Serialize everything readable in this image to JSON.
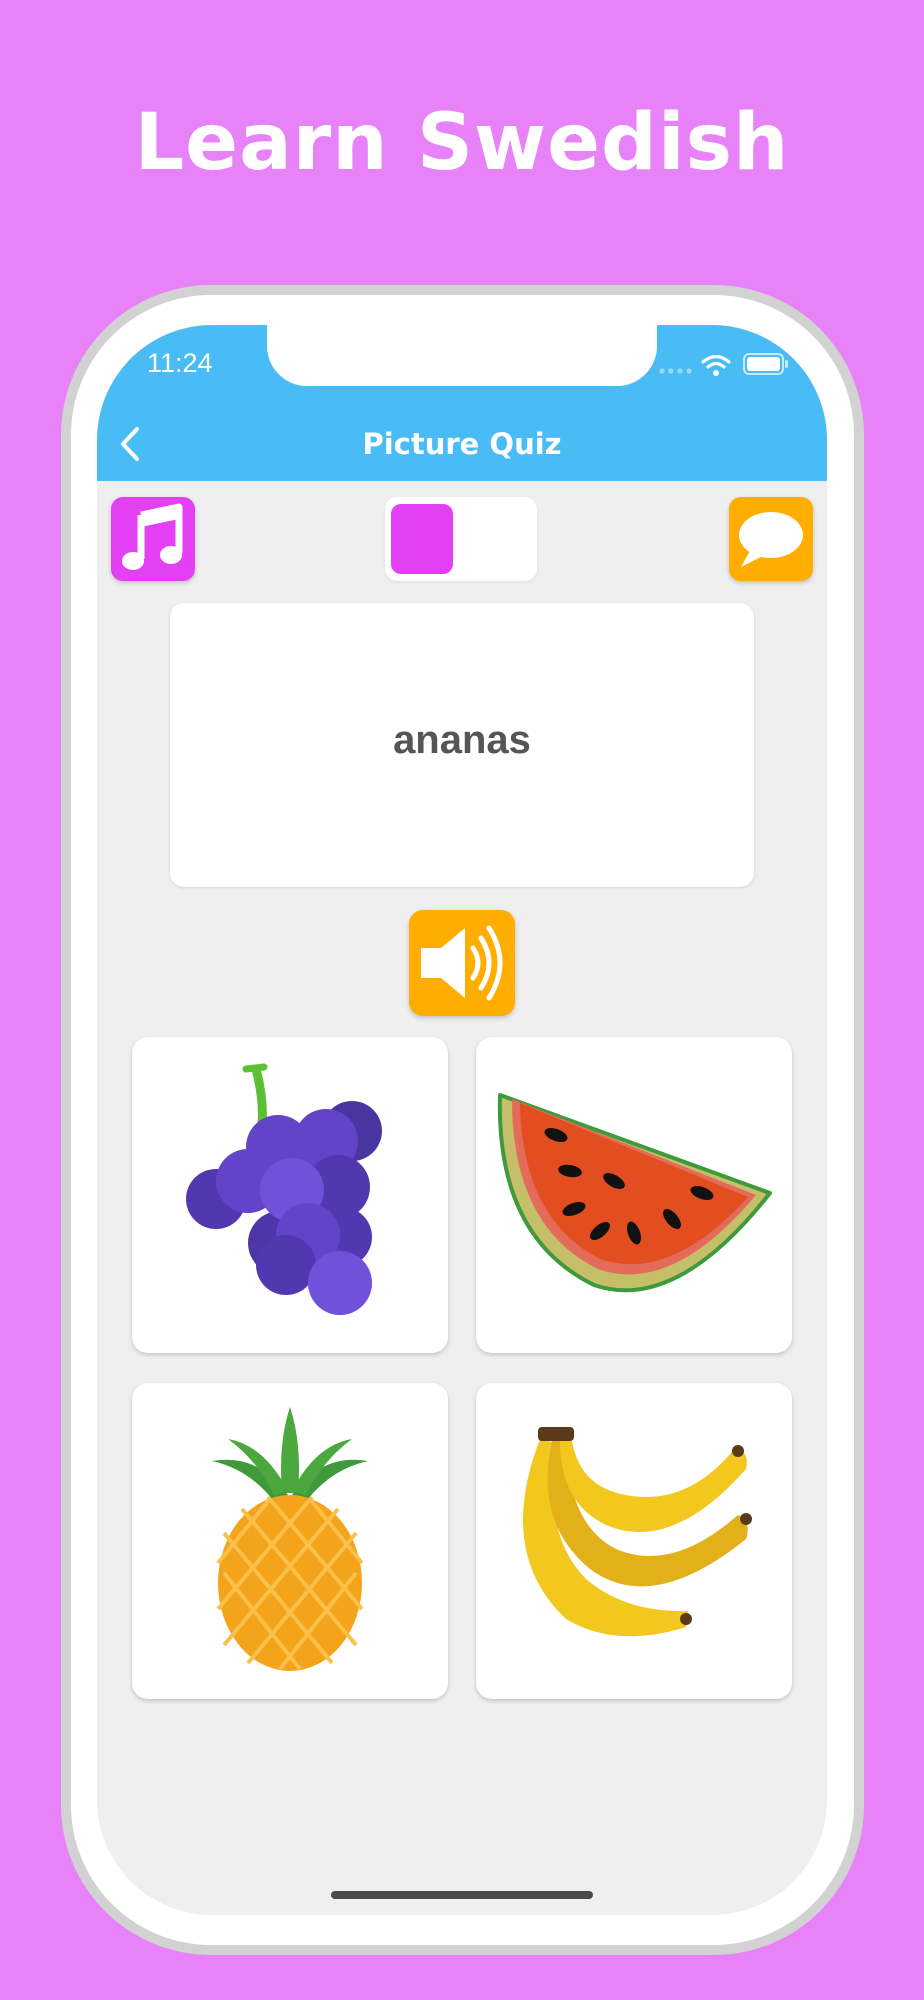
{
  "promo": {
    "title": "Learn Swedish"
  },
  "status_bar": {
    "time": "11:24"
  },
  "nav": {
    "title": "Picture Quiz"
  },
  "quiz": {
    "word": "ananas"
  },
  "options": [
    {
      "icon": "grapes-icon"
    },
    {
      "icon": "watermelon-icon"
    },
    {
      "icon": "pineapple-icon"
    },
    {
      "icon": "banana-icon"
    }
  ],
  "colors": {
    "background": "#E882F9",
    "header": "#49BCF6",
    "accent_pink": "#E440F3",
    "accent_orange": "#FFAE00",
    "screen_bg": "#EFEFEF"
  }
}
